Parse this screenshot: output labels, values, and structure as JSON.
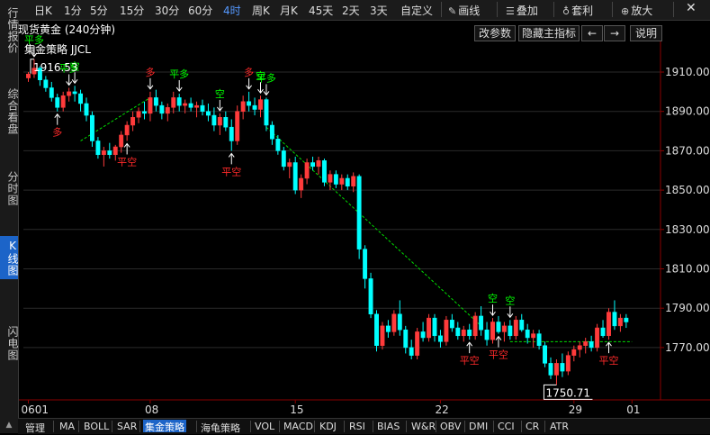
{
  "sidebar": {
    "tabs": [
      {
        "label": "行情报价",
        "active": false
      },
      {
        "label": "综合看盘",
        "active": false
      },
      {
        "label": "分时图",
        "active": false
      },
      {
        "label": "K线图",
        "active": true
      },
      {
        "label": "闪电图",
        "active": false
      }
    ]
  },
  "toolbar": {
    "periods": [
      "日K",
      "1分",
      "5分",
      "15分",
      "30分",
      "60分",
      "4时",
      "周K",
      "月K",
      "45天",
      "2天",
      "3天",
      "自定义"
    ],
    "active_period": "4时",
    "draw_label": "画线",
    "overlay_label": "叠加",
    "arbitrage_label": "套利",
    "zoom_label": "放大",
    "draw_icon": "pen-icon",
    "overlay_icon": "layers-icon",
    "arbitrage_icon": "bag-icon",
    "zoom_icon": "magnifier-icon"
  },
  "header": {
    "title": "现货黄金 (240分钟)",
    "strategy": "集金策略 JJCL",
    "buttons": {
      "params": "改参数",
      "hide_main": "隐藏主指标",
      "prev": "←",
      "next": "→",
      "help": "说明"
    }
  },
  "indicators": {
    "tabs": [
      "管理",
      "MA",
      "BOLL",
      "SAR",
      "集金策略",
      "海龟策略",
      "VOL",
      "MACD",
      "KDJ",
      "RSI",
      "BIAS",
      "W&R",
      "OBV",
      "DMI",
      "CCI",
      "CR",
      "ATR"
    ],
    "active": "集金策略"
  },
  "colors": {
    "up": "#ff3b3b",
    "down": "#00ffff",
    "signal_green": "#00ff00",
    "signal_red": "#ff2a2a",
    "axis": "#8a0000",
    "accent": "#1c64c8"
  },
  "chart_data": {
    "type": "candlestick",
    "price_axis": {
      "ticks": [
        1910,
        1890,
        1870,
        1850,
        1830,
        1810,
        1790,
        1770
      ],
      "tick_labels": [
        "1910.00",
        "1890.00",
        "1870.00",
        "1850.00",
        "1830.00",
        "1810.00",
        "1790.00",
        "1770.00"
      ]
    },
    "date_labels": [
      "0601",
      "08",
      "15",
      "22",
      "29",
      "01"
    ],
    "date_label_candle_index": [
      0,
      21,
      46,
      71,
      94,
      104
    ],
    "max_label": "1916.53",
    "min_label": "1750.71",
    "candles": [
      [
        1907,
        1910,
        1905,
        1909
      ],
      [
        1909,
        1916.5,
        1907,
        1912
      ],
      [
        1912,
        1913,
        1903,
        1906
      ],
      [
        1906,
        1908,
        1900,
        1902
      ],
      [
        1902,
        1905,
        1895,
        1897
      ],
      [
        1897,
        1899,
        1890,
        1892
      ],
      [
        1892,
        1900,
        1890,
        1898
      ],
      [
        1898,
        1902,
        1895,
        1900
      ],
      [
        1900,
        1903,
        1895,
        1899
      ],
      [
        1899,
        1901,
        1890,
        1894
      ],
      [
        1894,
        1897,
        1885,
        1888
      ],
      [
        1888,
        1890,
        1872,
        1875
      ],
      [
        1875,
        1877,
        1866,
        1868
      ],
      [
        1868,
        1872,
        1862,
        1870
      ],
      [
        1870,
        1874,
        1866,
        1868
      ],
      [
        1868,
        1873,
        1865,
        1872
      ],
      [
        1872,
        1880,
        1869,
        1878
      ],
      [
        1878,
        1885,
        1875,
        1883
      ],
      [
        1883,
        1890,
        1880,
        1887
      ],
      [
        1887,
        1892,
        1884,
        1890
      ],
      [
        1890,
        1895,
        1886,
        1889
      ],
      [
        1889,
        1900,
        1885,
        1897
      ],
      [
        1897,
        1901,
        1890,
        1893
      ],
      [
        1893,
        1895,
        1886,
        1889
      ],
      [
        1889,
        1894,
        1885,
        1892
      ],
      [
        1892,
        1900,
        1889,
        1897
      ],
      [
        1897,
        1899,
        1890,
        1893
      ],
      [
        1893,
        1896,
        1889,
        1894
      ],
      [
        1894,
        1897,
        1890,
        1892
      ],
      [
        1892,
        1895,
        1887,
        1893
      ],
      [
        1893,
        1896,
        1888,
        1890
      ],
      [
        1890,
        1894,
        1885,
        1888
      ],
      [
        1888,
        1892,
        1880,
        1883
      ],
      [
        1883,
        1889,
        1878,
        1887
      ],
      [
        1887,
        1890,
        1880,
        1882
      ],
      [
        1882,
        1886,
        1870,
        1875
      ],
      [
        1875,
        1893,
        1873,
        1890
      ],
      [
        1890,
        1898,
        1886,
        1895
      ],
      [
        1895,
        1900,
        1890,
        1893
      ],
      [
        1893,
        1897,
        1888,
        1891
      ],
      [
        1891,
        1898,
        1887,
        1896
      ],
      [
        1896,
        1897,
        1880,
        1883
      ],
      [
        1883,
        1885,
        1873,
        1876
      ],
      [
        1876,
        1878,
        1868,
        1870
      ],
      [
        1870,
        1872,
        1860,
        1862
      ],
      [
        1862,
        1866,
        1856,
        1864
      ],
      [
        1864,
        1867,
        1848,
        1850
      ],
      [
        1850,
        1858,
        1846,
        1856
      ],
      [
        1856,
        1866,
        1853,
        1864
      ],
      [
        1864,
        1867,
        1860,
        1862
      ],
      [
        1862,
        1867,
        1858,
        1865
      ],
      [
        1865,
        1866,
        1852,
        1854
      ],
      [
        1854,
        1860,
        1850,
        1858
      ],
      [
        1858,
        1860,
        1851,
        1853
      ],
      [
        1853,
        1858,
        1850,
        1856
      ],
      [
        1856,
        1858,
        1850,
        1852
      ],
      [
        1852,
        1859,
        1849,
        1857
      ],
      [
        1857,
        1858,
        1815,
        1820
      ],
      [
        1820,
        1822,
        1800,
        1805
      ],
      [
        1805,
        1808,
        1785,
        1787
      ],
      [
        1787,
        1789,
        1768,
        1771
      ],
      [
        1771,
        1783,
        1769,
        1781
      ],
      [
        1781,
        1784,
        1775,
        1778
      ],
      [
        1778,
        1789,
        1776,
        1787
      ],
      [
        1787,
        1794,
        1776,
        1779
      ],
      [
        1779,
        1781,
        1767,
        1770
      ],
      [
        1770,
        1774,
        1764,
        1766
      ],
      [
        1766,
        1780,
        1764,
        1778
      ],
      [
        1778,
        1783,
        1773,
        1775
      ],
      [
        1775,
        1787,
        1773,
        1785
      ],
      [
        1785,
        1787,
        1773,
        1776
      ],
      [
        1776,
        1779,
        1770,
        1773
      ],
      [
        1773,
        1786,
        1771,
        1784
      ],
      [
        1784,
        1787,
        1778,
        1780
      ],
      [
        1780,
        1783,
        1774,
        1776
      ],
      [
        1776,
        1781,
        1773,
        1779
      ],
      [
        1779,
        1782,
        1774,
        1776
      ],
      [
        1776,
        1788,
        1774,
        1786
      ],
      [
        1786,
        1791,
        1776,
        1779
      ],
      [
        1779,
        1783,
        1771,
        1774
      ],
      [
        1774,
        1785,
        1772,
        1783
      ],
      [
        1783,
        1786,
        1777,
        1778
      ],
      [
        1778,
        1783,
        1773,
        1781
      ],
      [
        1781,
        1784,
        1774,
        1776
      ],
      [
        1776,
        1786,
        1774,
        1784
      ],
      [
        1784,
        1787,
        1778,
        1779
      ],
      [
        1779,
        1782,
        1772,
        1775
      ],
      [
        1775,
        1779,
        1770,
        1777
      ],
      [
        1777,
        1779,
        1769,
        1771
      ],
      [
        1771,
        1773,
        1760,
        1762
      ],
      [
        1762,
        1765,
        1754,
        1756
      ],
      [
        1756,
        1764,
        1751,
        1762
      ],
      [
        1762,
        1767,
        1755,
        1758
      ],
      [
        1758,
        1768,
        1756,
        1766
      ],
      [
        1766,
        1771,
        1763,
        1769
      ],
      [
        1769,
        1773,
        1765,
        1771
      ],
      [
        1771,
        1775,
        1767,
        1773
      ],
      [
        1773,
        1776,
        1768,
        1770
      ],
      [
        1770,
        1782,
        1768,
        1780
      ],
      [
        1780,
        1784,
        1775,
        1776
      ],
      [
        1776,
        1790,
        1774,
        1788
      ],
      [
        1788,
        1794,
        1779,
        1781
      ],
      [
        1781,
        1787,
        1778,
        1785
      ],
      [
        1785,
        1787,
        1780,
        1783
      ]
    ],
    "signals": [
      {
        "i": 1,
        "type": "平多",
        "side": "top"
      },
      {
        "i": 5,
        "type": "多",
        "side": "bottom"
      },
      {
        "i": 7,
        "type": "平多",
        "side": "top"
      },
      {
        "i": 8,
        "type": "空",
        "side": "top"
      },
      {
        "i": 17,
        "type": "平空",
        "side": "bottom"
      },
      {
        "i": 21,
        "type": "多",
        "side": "top"
      },
      {
        "i": 26,
        "type": "平多",
        "side": "top"
      },
      {
        "i": 33,
        "type": "空",
        "side": "top"
      },
      {
        "i": 35,
        "type": "平空",
        "side": "bottom"
      },
      {
        "i": 38,
        "type": "多",
        "side": "top"
      },
      {
        "i": 41,
        "type": "平多",
        "side": "top"
      },
      {
        "i": 40,
        "type": "空",
        "side": "top"
      },
      {
        "i": 76,
        "type": "平空",
        "side": "bottom"
      },
      {
        "i": 80,
        "type": "空",
        "side": "top"
      },
      {
        "i": 81,
        "type": "平空",
        "side": "bottom"
      },
      {
        "i": 83,
        "type": "空",
        "side": "top"
      },
      {
        "i": 100,
        "type": "平空",
        "side": "bottom"
      }
    ],
    "trend_lines": [
      {
        "from": [
          9,
          1875
        ],
        "to": [
          21,
          1897
        ],
        "color": "green"
      },
      {
        "from": [
          41,
          1882
        ],
        "to": [
          78,
          1781
        ],
        "color": "green"
      },
      {
        "from": [
          83,
          1773
        ],
        "to": [
          104,
          1773
        ],
        "color": "green"
      }
    ]
  }
}
